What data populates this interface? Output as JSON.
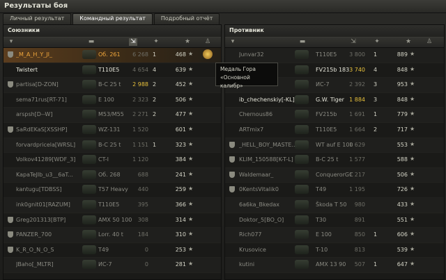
{
  "window": {
    "title": "Результаты боя"
  },
  "tabs": [
    {
      "label": "Личный результат",
      "active": false
    },
    {
      "label": "Командный результат",
      "active": true
    },
    {
      "label": "Подробный отчёт",
      "active": false
    }
  ],
  "allies": {
    "title": "Союзники",
    "rows": [
      {
        "name": "_M_A_H_Y_JI_",
        "tank": "Об. 261",
        "damage": "6 268",
        "frags": "1",
        "xp": "468",
        "me": true,
        "platoon": true
      },
      {
        "name": "Twistert",
        "tank": "T110E5",
        "damage": "4 654",
        "frags": "4",
        "xp": "639",
        "alive": true
      },
      {
        "name": "partisa[D-ZON]",
        "tank": "B-C 25 t",
        "damage": "2 988",
        "frags": "2",
        "xp": "452",
        "gold": true,
        "platoon": true
      },
      {
        "name": "sema71rus[RT-71]",
        "tank": "E 100",
        "damage": "2 323",
        "frags": "2",
        "xp": "506"
      },
      {
        "name": "arspsh[D--W]",
        "tank": "M53/M55",
        "damage": "2 271",
        "frags": "2",
        "xp": "477"
      },
      {
        "name": "SaRdEKaS[XSSHP]",
        "tank": "WZ-131",
        "damage": "1 520",
        "frags": "",
        "xp": "601",
        "platoon": true
      },
      {
        "name": "forvardpricela[WRSL]",
        "tank": "B-C 25 t",
        "damage": "1 151",
        "frags": "1",
        "xp": "323"
      },
      {
        "name": "Volkov41289[WDF_3]",
        "tank": "CT-I",
        "damage": "1 120",
        "frags": "",
        "xp": "384"
      },
      {
        "name": "KapaTeJIb_u3__6aT...",
        "tank": "Об. 268",
        "damage": "688",
        "frags": "",
        "xp": "241"
      },
      {
        "name": "kantugu[TDBSS]",
        "tank": "T57 Heavy",
        "damage": "440",
        "frags": "",
        "xp": "259"
      },
      {
        "name": "ink0gnit01[RAZUM]",
        "tank": "T110E5",
        "damage": "395",
        "frags": "",
        "xp": "366"
      },
      {
        "name": "Greg201313[BTP]",
        "tank": "AMX 50 100",
        "damage": "308",
        "frags": "",
        "xp": "314",
        "platoon": true
      },
      {
        "name": "PANZER_700",
        "tank": "Lorr. 40 t",
        "damage": "184",
        "frags": "",
        "xp": "310",
        "platoon": true
      },
      {
        "name": "K_R_O_N_O_S",
        "tank": "T49",
        "damage": "0",
        "frags": "",
        "xp": "253",
        "platoon": true
      },
      {
        "name": "JBaho[_MLTR]",
        "tank": "ИС-7",
        "damage": "0",
        "frags": "",
        "xp": "281"
      }
    ]
  },
  "enemies": {
    "title": "Противник",
    "rows": [
      {
        "name": "Junvar32",
        "tank": "T110E5",
        "damage": "3 800",
        "frags": "1",
        "xp": "889"
      },
      {
        "name": "",
        "tank": "FV215b 183",
        "damage": "3 740",
        "frags": "4",
        "xp": "848",
        "alive": true,
        "gold": true
      },
      {
        "name": "",
        "tank": "ИС-7",
        "damage": "2 392",
        "frags": "3",
        "xp": "953"
      },
      {
        "name": "ib_chechenskiy[-KL]",
        "tank": "G.W. Tiger",
        "damage": "1 884",
        "frags": "3",
        "xp": "848",
        "alive": true,
        "gold": true
      },
      {
        "name": "Chernous86",
        "tank": "FV215b",
        "damage": "1 691",
        "frags": "1",
        "xp": "779"
      },
      {
        "name": "ARTmix7",
        "tank": "T110E5",
        "damage": "1 664",
        "frags": "2",
        "xp": "717"
      },
      {
        "name": "_HELL_BOY_MASTE...",
        "tank": "WT auf E 100",
        "damage": "1 629",
        "frags": "",
        "xp": "553",
        "platoon": true
      },
      {
        "name": "KLIM_150588[K-T-L]",
        "tank": "B-C 25 t",
        "damage": "1 577",
        "frags": "",
        "xp": "588",
        "platoon": true
      },
      {
        "name": "Waldemaar_",
        "tank": "ConquerorGC",
        "damage": "1 217",
        "frags": "",
        "xp": "506",
        "platoon": true
      },
      {
        "name": "0KentsVitalik0",
        "tank": "T49",
        "damage": "1 195",
        "frags": "",
        "xp": "726",
        "platoon": true
      },
      {
        "name": "6a6ka_Bkedax",
        "tank": "Škoda T 50",
        "damage": "980",
        "frags": "",
        "xp": "433"
      },
      {
        "name": "Doktor_5[BO_O]",
        "tank": "T30",
        "damage": "891",
        "frags": "",
        "xp": "551"
      },
      {
        "name": "Rich077",
        "tank": "E 100",
        "damage": "850",
        "frags": "1",
        "xp": "606"
      },
      {
        "name": "Krusovice",
        "tank": "T-10",
        "damage": "813",
        "frags": "",
        "xp": "539"
      },
      {
        "name": "kutini",
        "tank": "AMX 13 90",
        "damage": "507",
        "frags": "1",
        "xp": "647"
      }
    ]
  },
  "tooltip": {
    "line1": "Медаль Гора",
    "line2": "«Основной калибр»"
  },
  "star_glyph": "★"
}
